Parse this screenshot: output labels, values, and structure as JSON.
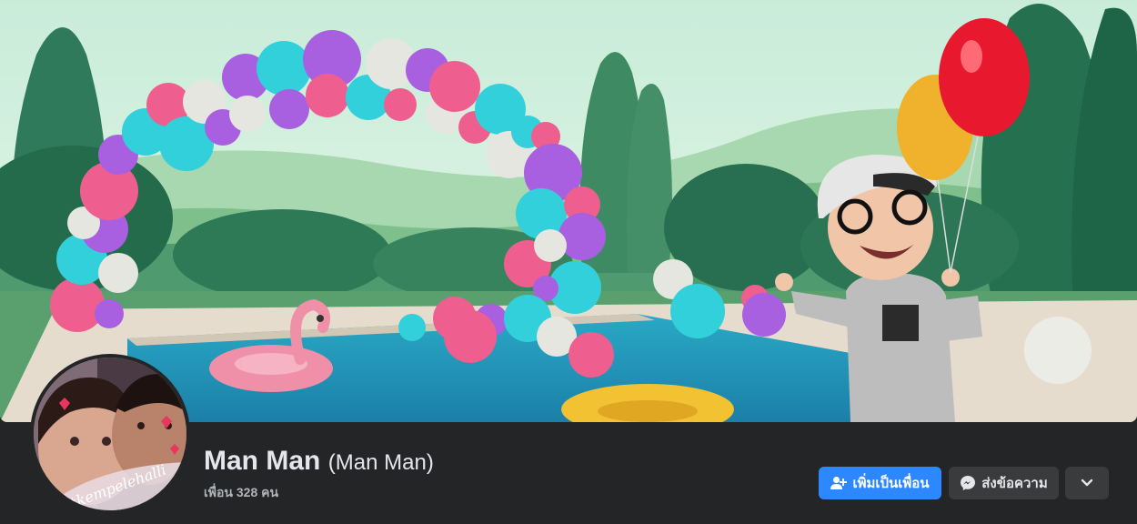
{
  "profile": {
    "name": "Man Man",
    "alternate_name": "(Man Man)",
    "friends_text": "เพื่อน 328 คน"
  },
  "avatar": {
    "caption": "#kempelehalli"
  },
  "actions": {
    "add_friend_label": "เพิ่มเป็นเพื่อน",
    "message_label": "ส่งข้อความ",
    "more_icon": "chevron-down-icon"
  },
  "colors": {
    "page_bg": "#242526",
    "primary_button": "#2d88ff",
    "secondary_button": "#3a3b3c",
    "text_primary": "#e4e6eb",
    "text_secondary": "#b0b3b8"
  }
}
